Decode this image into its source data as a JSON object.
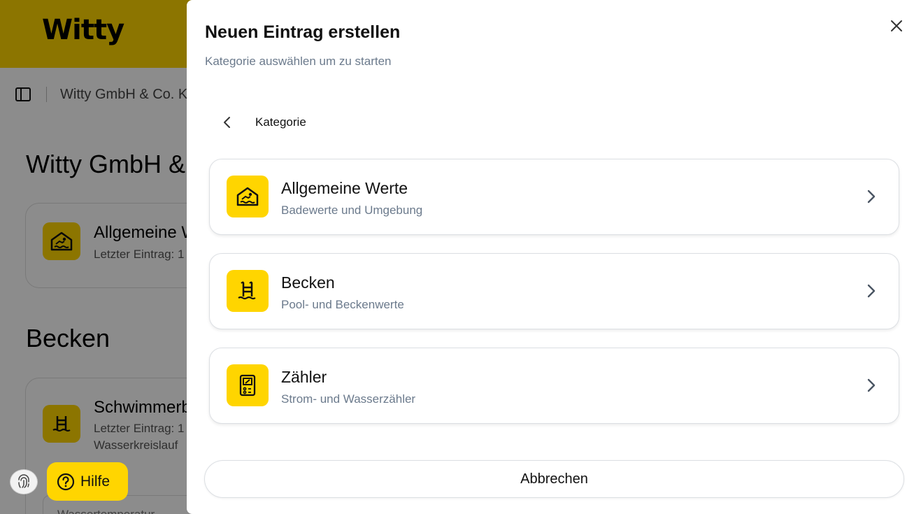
{
  "background": {
    "logo": "Witty",
    "breadcrumb": "Witty GmbH & Co. K",
    "section_title_1": "Witty GmbH &",
    "section_title_2": "Becken",
    "card1": {
      "title": "Allgemeine W",
      "sub": "Letzter Eintrag: 1"
    },
    "card2": {
      "title": "Schwimmerb",
      "sub": "Letzter Eintrag: 1",
      "sub2": "Wasserkreislauf"
    },
    "partial_label": "Wassertemperatur",
    "help_label": "Hilfe"
  },
  "drawer": {
    "title": "Neuen Eintrag erstellen",
    "subtitle": "Kategorie auswählen um zu starten",
    "breadcrumb": "Kategorie",
    "categories": [
      {
        "title": "Allgemeine Werte",
        "subtitle": "Badewerte und Umgebung",
        "icon": "pool-house-icon"
      },
      {
        "title": "Becken",
        "subtitle": "Pool- und Beckenwerte",
        "icon": "pool-ladder-icon"
      },
      {
        "title": "Zähler",
        "subtitle": "Strom- und Wasserzähler",
        "icon": "meter-icon"
      }
    ],
    "cancel_label": "Abbrechen"
  },
  "colors": {
    "accent": "#FFD500",
    "muted_text": "#6b7a8c"
  }
}
